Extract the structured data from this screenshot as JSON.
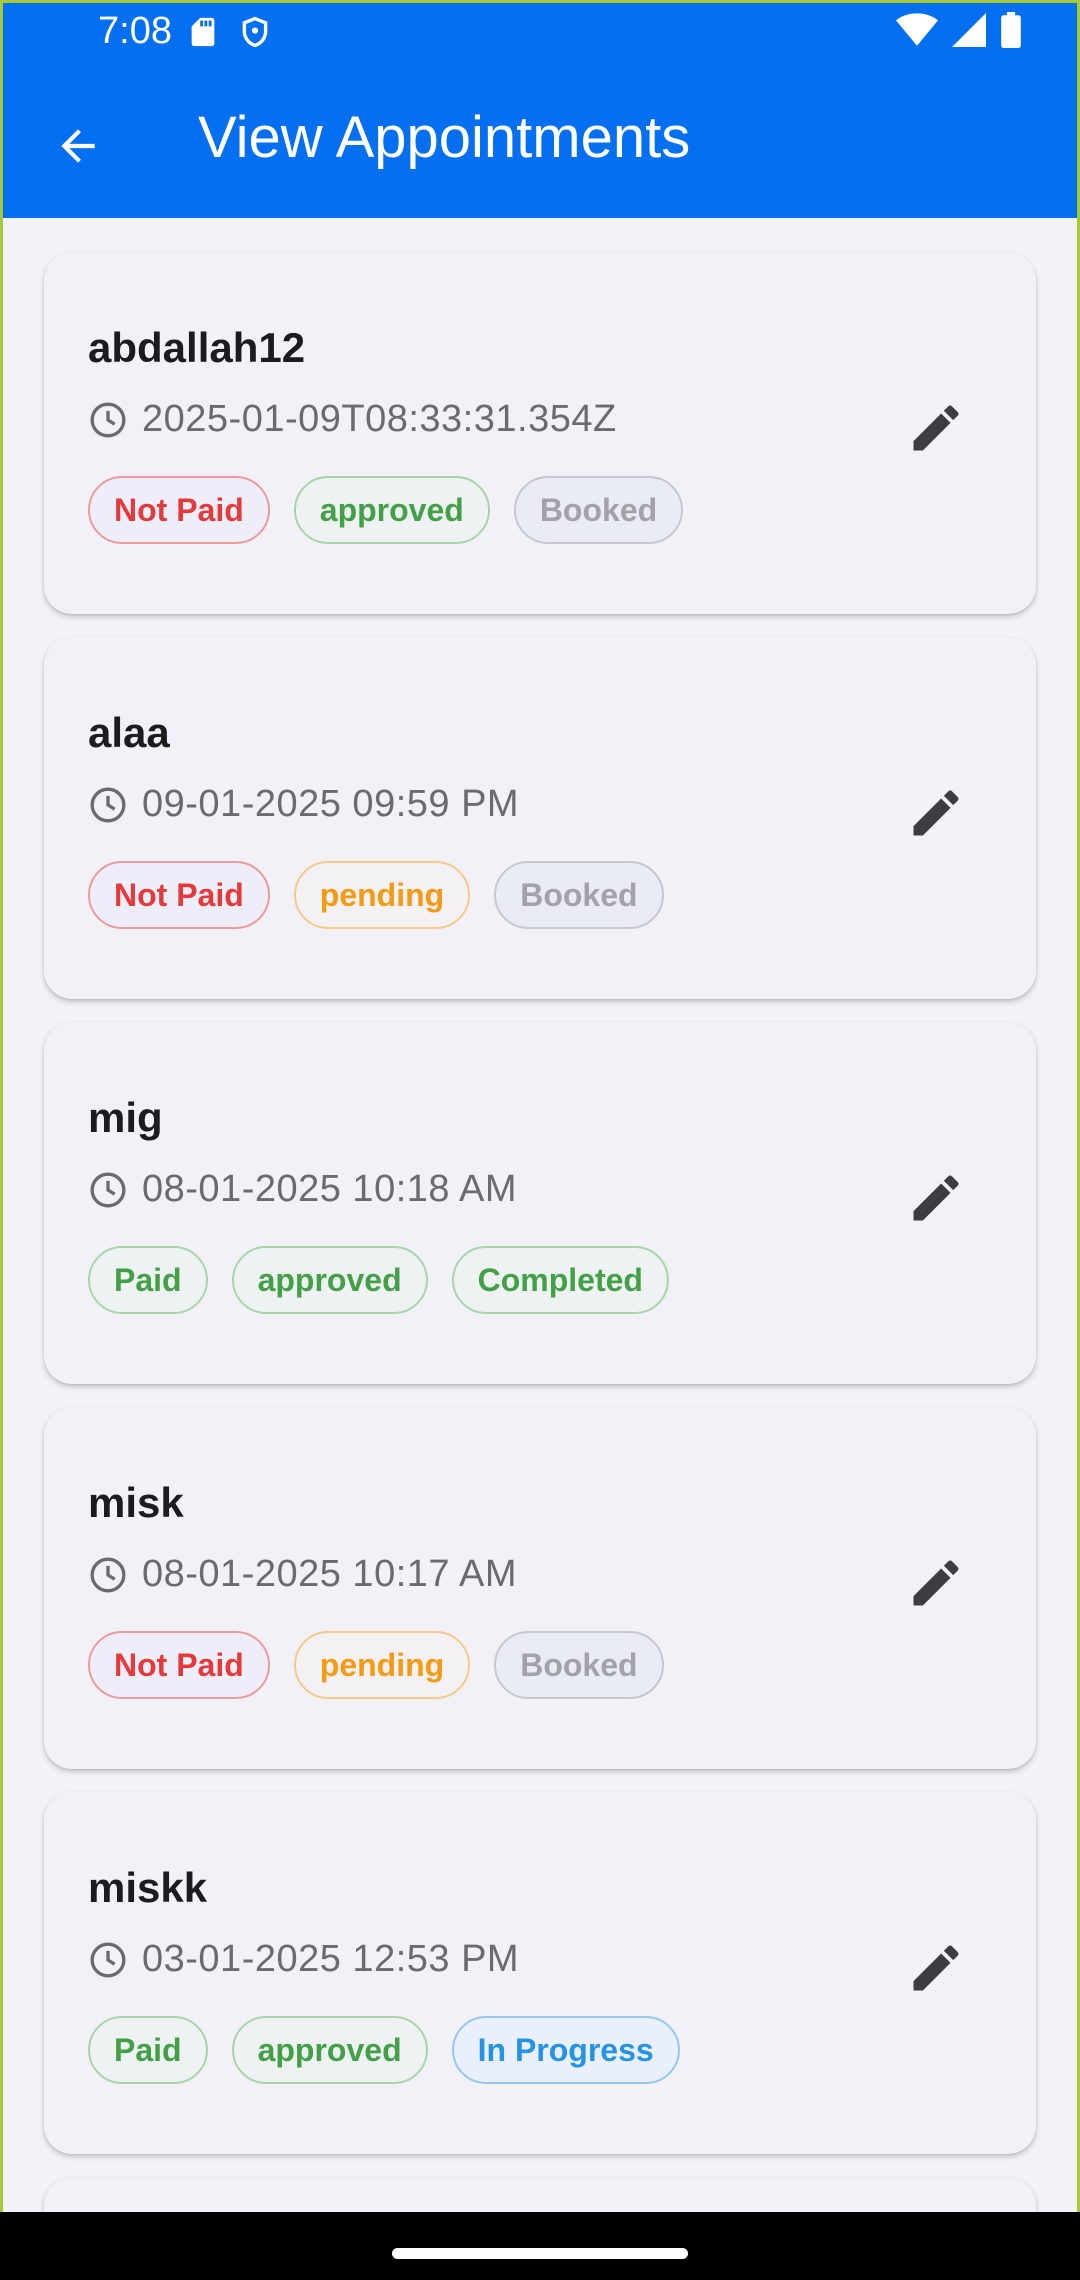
{
  "status_bar": {
    "time": "7:08",
    "left_icons": [
      "sd-card-icon",
      "shield-icon"
    ],
    "right_icons": [
      "wifi-icon",
      "signal-icon",
      "battery-icon"
    ]
  },
  "app_bar": {
    "title": "View Appointments",
    "back_icon": "arrow-back-icon"
  },
  "appointments": [
    {
      "name": "abdallah12",
      "time": "2025-01-09T08:33:31.354Z",
      "chips": [
        {
          "label": "Not Paid",
          "color": "red"
        },
        {
          "label": "approved",
          "color": "green"
        },
        {
          "label": "Booked",
          "color": "grey"
        }
      ]
    },
    {
      "name": "alaa",
      "time": "09-01-2025 09:59 PM",
      "chips": [
        {
          "label": "Not Paid",
          "color": "red"
        },
        {
          "label": "pending",
          "color": "orange"
        },
        {
          "label": "Booked",
          "color": "grey"
        }
      ]
    },
    {
      "name": "mig",
      "time": "08-01-2025 10:18 AM",
      "chips": [
        {
          "label": "Paid",
          "color": "green"
        },
        {
          "label": "approved",
          "color": "green"
        },
        {
          "label": "Completed",
          "color": "green"
        }
      ]
    },
    {
      "name": "misk",
      "time": "08-01-2025 10:17 AM",
      "chips": [
        {
          "label": "Not Paid",
          "color": "red"
        },
        {
          "label": "pending",
          "color": "orange"
        },
        {
          "label": "Booked",
          "color": "grey"
        }
      ]
    },
    {
      "name": "miskk",
      "time": "03-01-2025 12:53 PM",
      "chips": [
        {
          "label": "Paid",
          "color": "green"
        },
        {
          "label": "approved",
          "color": "green"
        },
        {
          "label": "In Progress",
          "color": "blue"
        }
      ]
    }
  ],
  "colors": {
    "app_bar": "#0470f1",
    "background": "#f3f2f9",
    "card": "#f2f1f8",
    "red": "#e5393a",
    "green": "#43a047",
    "orange": "#f59a14",
    "grey": "#a2a2a8",
    "blue": "#2493e6"
  }
}
